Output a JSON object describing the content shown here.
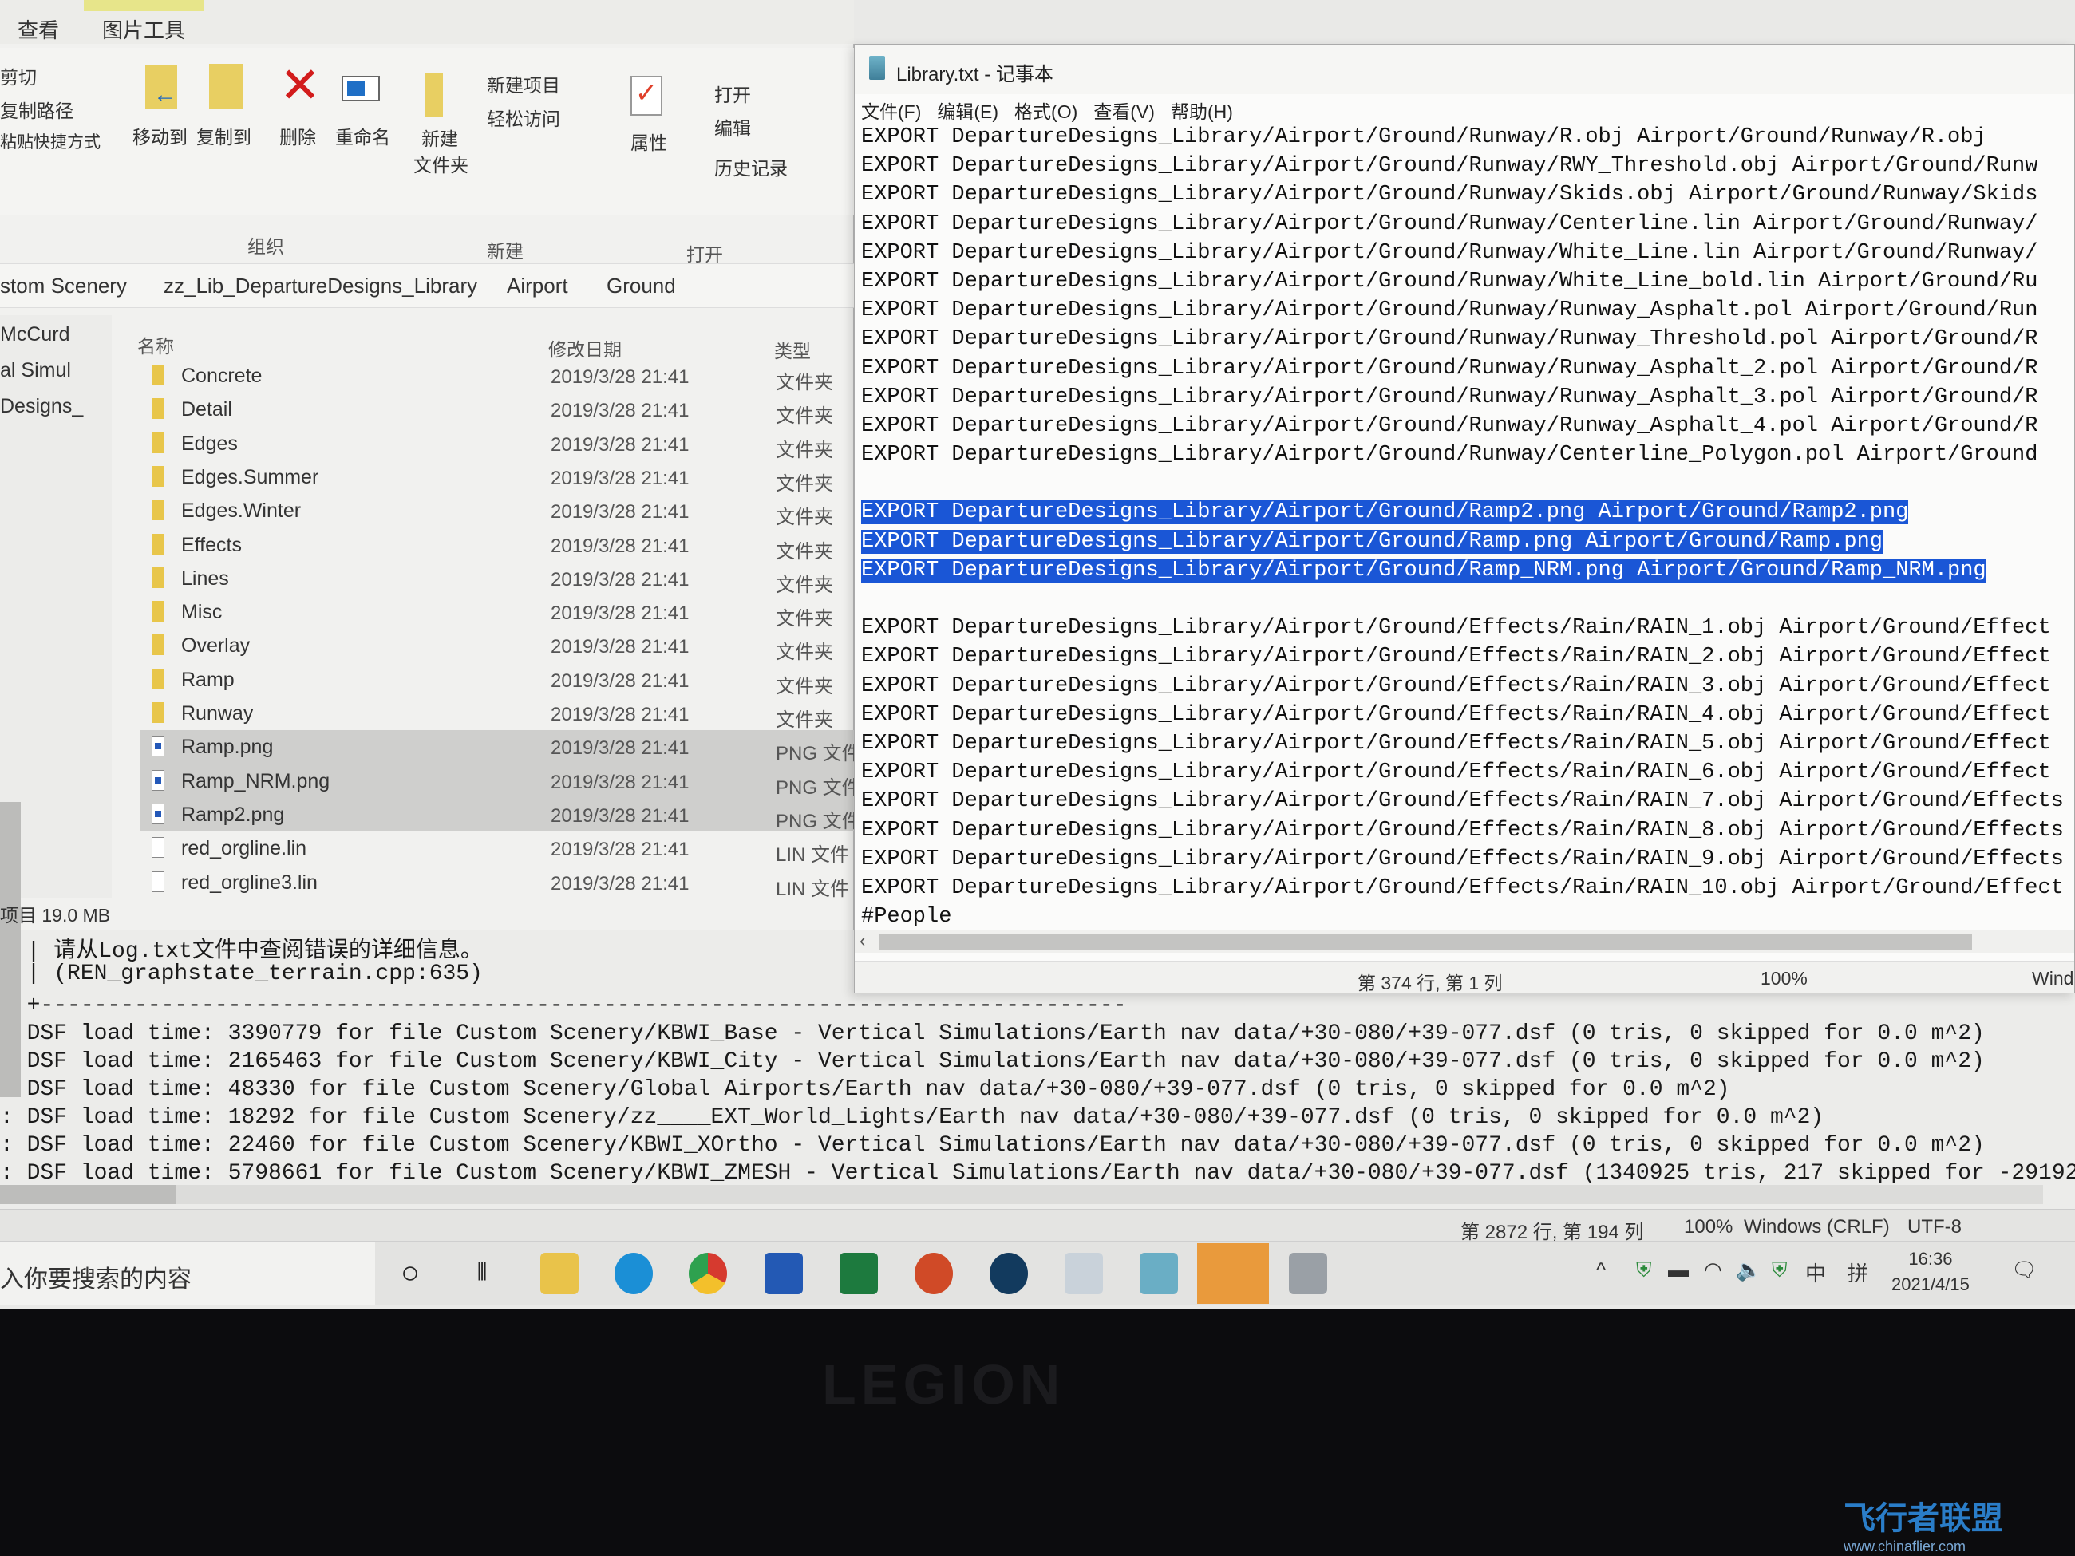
{
  "explorer": {
    "ribbon_tabs": [
      "查看",
      "图片工具"
    ],
    "clipboard": [
      "剪切",
      "复制路径",
      "粘贴快捷方式"
    ],
    "organize": {
      "move_to": "移动到",
      "copy_to": "复制到",
      "delete": "删除",
      "rename": "重命名",
      "group": "组织"
    },
    "new": {
      "new_folder_1": "新建",
      "new_folder_2": "文件夹",
      "new_item": "新建项目",
      "easy_access": "轻松访问",
      "group": "新建"
    },
    "open": {
      "properties": "属性",
      "open": "打开",
      "edit": "编辑",
      "history": "历史记录",
      "group": "打开"
    },
    "breadcrumb": [
      "stom Scenery",
      "zz_Lib_DepartureDesigns_Library",
      "Airport",
      "Ground"
    ],
    "nav_items": [
      "McCurd",
      "al Simul",
      "Designs_",
      ")"
    ],
    "columns": {
      "name": "名称",
      "date": "修改日期",
      "type": "类型"
    },
    "files": [
      {
        "name": "Concrete",
        "date": "2019/3/28 21:41",
        "type": "文件夹",
        "kind": "folder"
      },
      {
        "name": "Detail",
        "date": "2019/3/28 21:41",
        "type": "文件夹",
        "kind": "folder"
      },
      {
        "name": "Edges",
        "date": "2019/3/28 21:41",
        "type": "文件夹",
        "kind": "folder"
      },
      {
        "name": "Edges.Summer",
        "date": "2019/3/28 21:41",
        "type": "文件夹",
        "kind": "folder"
      },
      {
        "name": "Edges.Winter",
        "date": "2019/3/28 21:41",
        "type": "文件夹",
        "kind": "folder"
      },
      {
        "name": "Effects",
        "date": "2019/3/28 21:41",
        "type": "文件夹",
        "kind": "folder"
      },
      {
        "name": "Lines",
        "date": "2019/3/28 21:41",
        "type": "文件夹",
        "kind": "folder"
      },
      {
        "name": "Misc",
        "date": "2019/3/28 21:41",
        "type": "文件夹",
        "kind": "folder"
      },
      {
        "name": "Overlay",
        "date": "2019/3/28 21:41",
        "type": "文件夹",
        "kind": "folder"
      },
      {
        "name": "Ramp",
        "date": "2019/3/28 21:41",
        "type": "文件夹",
        "kind": "folder"
      },
      {
        "name": "Runway",
        "date": "2019/3/28 21:41",
        "type": "文件夹",
        "kind": "folder"
      },
      {
        "name": "Ramp.png",
        "date": "2019/3/28 21:41",
        "type": "PNG 文件",
        "kind": "png",
        "selected": true
      },
      {
        "name": "Ramp_NRM.png",
        "date": "2019/3/28 21:41",
        "type": "PNG 文件",
        "kind": "png",
        "selected": true
      },
      {
        "name": "Ramp2.png",
        "date": "2019/3/28 21:41",
        "type": "PNG 文件",
        "kind": "png",
        "selected": true
      },
      {
        "name": "red_orgline.lin",
        "date": "2019/3/28 21:41",
        "type": "LIN 文件",
        "kind": "txt"
      },
      {
        "name": "red_orgline3.lin",
        "date": "2019/3/28 21:41",
        "type": "LIN 文件",
        "kind": "txt"
      }
    ],
    "status": "项目  19.0 MB"
  },
  "notepad": {
    "title": "Library.txt - 记事本",
    "menu": [
      "文件(F)",
      "编辑(E)",
      "格式(O)",
      "查看(V)",
      "帮助(H)"
    ],
    "lines": [
      {
        "text": "EXPORT DepartureDesigns_Library/Airport/Ground/Runway/R.obj Airport/Ground/Runway/R.obj"
      },
      {
        "text": "EXPORT DepartureDesigns_Library/Airport/Ground/Runway/RWY_Threshold.obj Airport/Ground/Runw"
      },
      {
        "text": "EXPORT DepartureDesigns_Library/Airport/Ground/Runway/Skids.obj Airport/Ground/Runway/Skids"
      },
      {
        "text": "EXPORT DepartureDesigns_Library/Airport/Ground/Runway/Centerline.lin Airport/Ground/Runway/"
      },
      {
        "text": "EXPORT DepartureDesigns_Library/Airport/Ground/Runway/White_Line.lin Airport/Ground/Runway/"
      },
      {
        "text": "EXPORT DepartureDesigns_Library/Airport/Ground/Runway/White_Line_bold.lin Airport/Ground/Ru"
      },
      {
        "text": "EXPORT DepartureDesigns_Library/Airport/Ground/Runway/Runway_Asphalt.pol Airport/Ground/Run"
      },
      {
        "text": "EXPORT DepartureDesigns_Library/Airport/Ground/Runway/Runway_Threshold.pol Airport/Ground/R"
      },
      {
        "text": "EXPORT DepartureDesigns_Library/Airport/Ground/Runway/Runway_Asphalt_2.pol Airport/Ground/R"
      },
      {
        "text": "EXPORT DepartureDesigns_Library/Airport/Ground/Runway/Runway_Asphalt_3.pol Airport/Ground/R"
      },
      {
        "text": "EXPORT DepartureDesigns_Library/Airport/Ground/Runway/Runway_Asphalt_4.pol Airport/Ground/R"
      },
      {
        "text": "EXPORT DepartureDesigns_Library/Airport/Ground/Runway/Centerline_Polygon.pol Airport/Ground"
      },
      {
        "text": ""
      },
      {
        "text": "EXPORT DepartureDesigns_Library/Airport/Ground/Ramp2.png Airport/Ground/Ramp2.png",
        "selected": true
      },
      {
        "text": "EXPORT DepartureDesigns_Library/Airport/Ground/Ramp.png Airport/Ground/Ramp.png",
        "selected": true
      },
      {
        "text": "EXPORT DepartureDesigns_Library/Airport/Ground/Ramp_NRM.png Airport/Ground/Ramp_NRM.png",
        "selected": true
      },
      {
        "text": ""
      },
      {
        "text": "EXPORT DepartureDesigns_Library/Airport/Ground/Effects/Rain/RAIN_1.obj Airport/Ground/Effect"
      },
      {
        "text": "EXPORT DepartureDesigns_Library/Airport/Ground/Effects/Rain/RAIN_2.obj Airport/Ground/Effect"
      },
      {
        "text": "EXPORT DepartureDesigns_Library/Airport/Ground/Effects/Rain/RAIN_3.obj Airport/Ground/Effect"
      },
      {
        "text": "EXPORT DepartureDesigns_Library/Airport/Ground/Effects/Rain/RAIN_4.obj Airport/Ground/Effect"
      },
      {
        "text": "EXPORT DepartureDesigns_Library/Airport/Ground/Effects/Rain/RAIN_5.obj Airport/Ground/Effect"
      },
      {
        "text": "EXPORT DepartureDesigns_Library/Airport/Ground/Effects/Rain/RAIN_6.obj Airport/Ground/Effect"
      },
      {
        "text": "EXPORT DepartureDesigns_Library/Airport/Ground/Effects/Rain/RAIN_7.obj Airport/Ground/Effects"
      },
      {
        "text": "EXPORT DepartureDesigns_Library/Airport/Ground/Effects/Rain/RAIN_8.obj Airport/Ground/Effects"
      },
      {
        "text": "EXPORT DepartureDesigns_Library/Airport/Ground/Effects/Rain/RAIN_9.obj Airport/Ground/Effects"
      },
      {
        "text": "EXPORT DepartureDesigns_Library/Airport/Ground/Effects/Rain/RAIN_10.obj Airport/Ground/Effect"
      },
      {
        "text": "#People"
      }
    ],
    "status": {
      "position": "第 374 行, 第 1 列",
      "zoom": "100%",
      "eol": "Wind"
    },
    "selection_color": "#1a56d6"
  },
  "log": {
    "lines": [
      ": | 请从Log.txt文件中查阅错误的详细信息。",
      ": | (REN_graphstate_terrain.cpp:635)",
      ": +---------------------------------------------------------------------------------",
      ": DSF load time: 3390779 for file Custom Scenery/KBWI_Base - Vertical Simulations/Earth nav data/+30-080/+39-077.dsf (0 tris, 0 skipped for 0.0 m^2)",
      ": DSF load time: 2165463 for file Custom Scenery/KBWI_City - Vertical Simulations/Earth nav data/+30-080/+39-077.dsf (0 tris, 0 skipped for 0.0 m^2)",
      ": DSF load time: 48330 for file Custom Scenery/Global Airports/Earth nav data/+30-080/+39-077.dsf (0 tris, 0 skipped for 0.0 m^2)",
      ": DSF load time: 18292 for file Custom Scenery/zz____EXT_World_Lights/Earth nav data/+30-080/+39-077.dsf (0 tris, 0 skipped for 0.0 m^2)",
      ": DSF load time: 22460 for file Custom Scenery/KBWI_XOrtho - Vertical Simulations/Earth nav data/+30-080/+39-077.dsf (0 tris, 0 skipped for 0.0 m^2)",
      ": DSF load time: 5798661 for file Custom Scenery/KBWI_ZMESH - Vertical Simulations/Earth nav data/+30-080/+39-077.dsf (1340925 tris, 217 skipped for -29192"
    ],
    "status": {
      "position": "第 2872 行, 第 194 列",
      "zoom": "100%",
      "eol": "Windows (CRLF)",
      "encoding": "UTF-8"
    }
  },
  "taskbar": {
    "search_placeholder": "入你要搜索的内容",
    "apps": [
      "cortana-icon",
      "task-view-icon",
      "file-explorer-icon",
      "edge-icon",
      "chrome-icon",
      "word-icon",
      "excel-icon",
      "powerpoint-icon",
      "xplane-icon",
      "photo-viewer-icon",
      "notepad-icon",
      "xplane-active-icon",
      "plane-maker-icon"
    ],
    "tray": [
      "^",
      "中",
      "拼"
    ],
    "time": "16:36",
    "date": "2021/4/15"
  },
  "bezel_logo": "LEGION",
  "watermark": {
    "title": "飞行者联盟",
    "url": "www.chinaflier.com"
  }
}
